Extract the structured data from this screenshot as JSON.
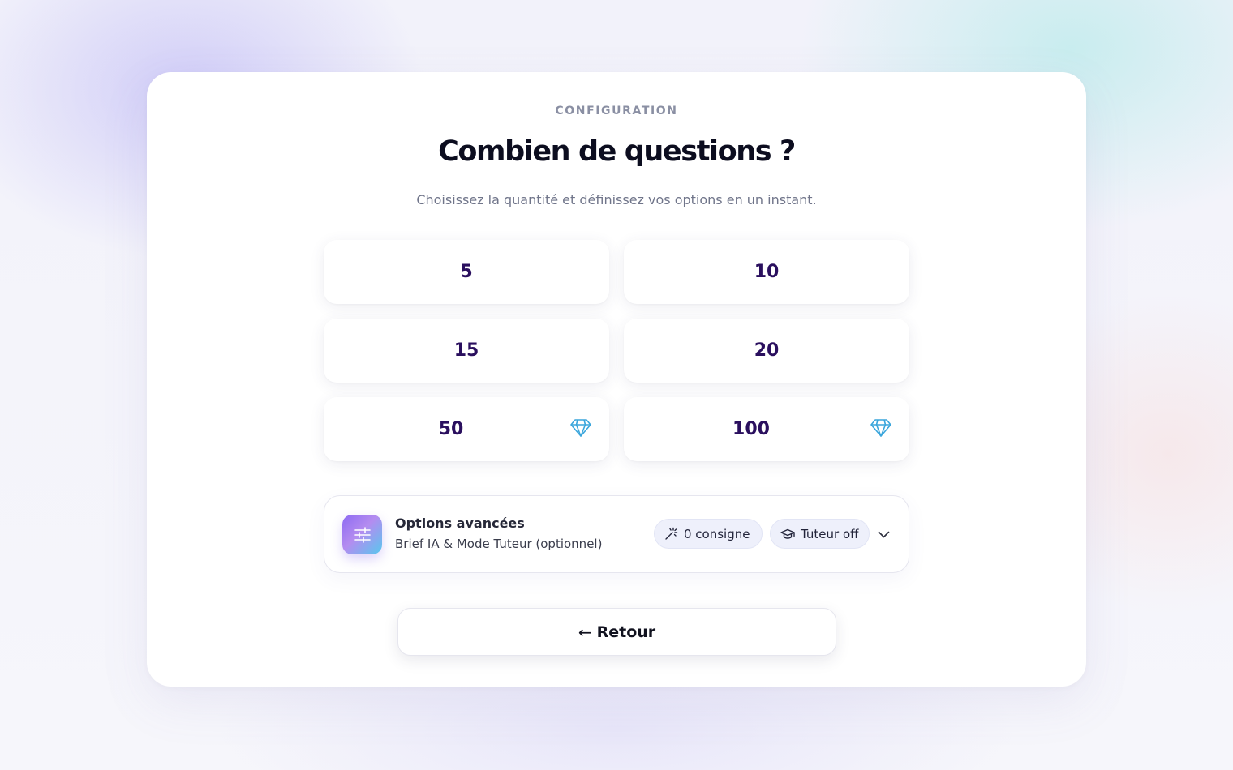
{
  "header": {
    "eyebrow": "CONFIGURATION",
    "title": "Combien de questions ?",
    "subtitle": "Choisissez la quantité et définissez vos options en un instant."
  },
  "options": [
    {
      "label": "5",
      "premium": false
    },
    {
      "label": "10",
      "premium": false
    },
    {
      "label": "15",
      "premium": false
    },
    {
      "label": "20",
      "premium": false
    },
    {
      "label": "50",
      "premium": true,
      "icon": "diamond-icon"
    },
    {
      "label": "100",
      "premium": true,
      "icon": "diamond-icon"
    }
  ],
  "advanced": {
    "icon": "sliders-icon",
    "title": "Options avancées",
    "subtitle": "Brief IA & Mode Tuteur (optionnel)",
    "chips": [
      {
        "icon": "magic-wand-icon",
        "label": "0 consigne"
      },
      {
        "icon": "graduation-cap-icon",
        "label": "Tuteur off"
      }
    ],
    "toggle_icon": "chevron-down-icon"
  },
  "back_button": {
    "arrow": "←",
    "label": "Retour"
  },
  "colors": {
    "option_text": "#2a0f5e",
    "title": "#0c0d1f",
    "gem": "#3ba6dc",
    "icon_gradient_start": "#8d6af2",
    "icon_gradient_end": "#57c8ee"
  }
}
